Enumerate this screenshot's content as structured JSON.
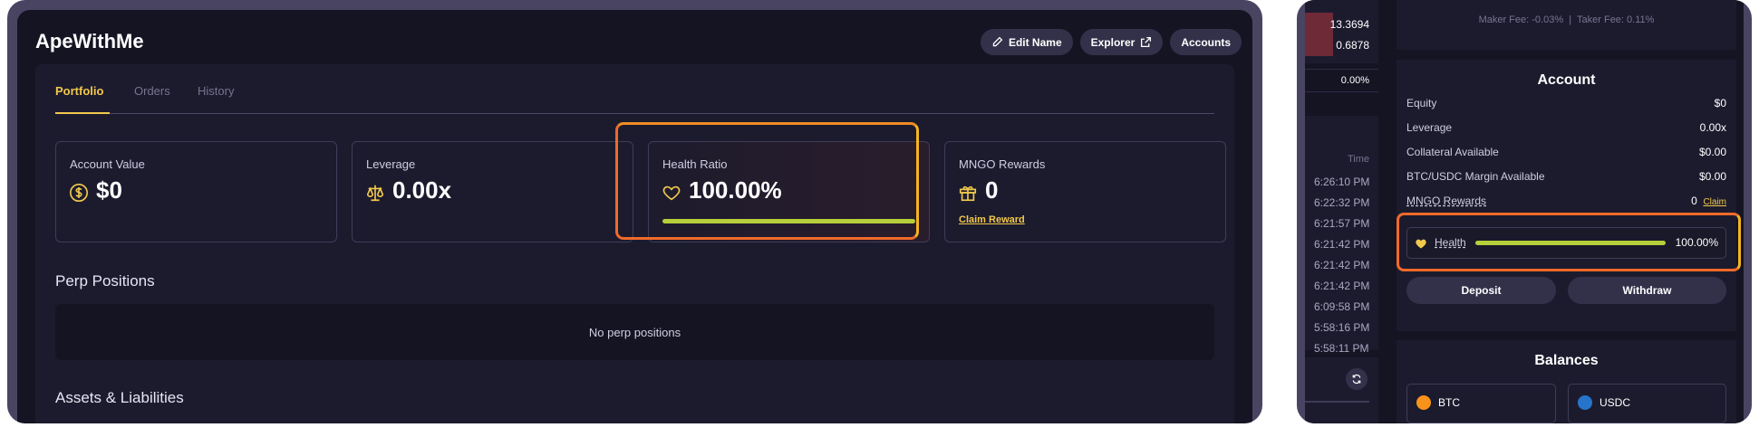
{
  "left": {
    "app_title": "ApeWithMe",
    "header_buttons": {
      "edit_name": "Edit Name",
      "explorer": "Explorer",
      "accounts": "Accounts"
    },
    "tabs": [
      "Portfolio",
      "Orders",
      "History"
    ],
    "stats": {
      "account_value": {
        "label": "Account Value",
        "value": "$0"
      },
      "leverage": {
        "label": "Leverage",
        "value": "0.00x"
      },
      "health_ratio": {
        "label": "Health Ratio",
        "value": "100.00%",
        "fill_fraction": 1.0
      },
      "mngo_rewards": {
        "label": "MNGO Rewards",
        "value": "0",
        "claim": "Claim Reward"
      }
    },
    "perp_positions": {
      "title": "Perp Positions",
      "empty": "No perp positions"
    },
    "assets_title": "Assets & Liabilities"
  },
  "right": {
    "trades": {
      "numbers": [
        "13.3694",
        "0.6878"
      ],
      "percent": "0.00%",
      "time_header": "Time",
      "times": [
        "6:26:10 PM",
        "6:22:32 PM",
        "6:21:57 PM",
        "6:21:42 PM",
        "6:21:42 PM",
        "6:21:42 PM",
        "6:09:58 PM",
        "5:58:16 PM",
        "5:58:11 PM"
      ]
    },
    "fees": {
      "maker": "Maker Fee: -0.03%",
      "sep": "|",
      "taker": "Taker Fee: 0.11%"
    },
    "account": {
      "title": "Account",
      "rows": [
        {
          "label": "Equity",
          "value": "$0"
        },
        {
          "label": "Leverage",
          "value": "0.00x"
        },
        {
          "label": "Collateral Available",
          "value": "$0.00"
        },
        {
          "label": "BTC/USDC Margin Available",
          "value": "$0.00"
        }
      ],
      "mngo_label": "MNGO Rewards",
      "mngo_value": "0",
      "mngo_claim": "Claim",
      "health_label": "Health",
      "health_value": "100.00%",
      "health_fill_fraction": 1.0,
      "deposit": "Deposit",
      "withdraw": "Withdraw"
    },
    "balances": {
      "title": "Balances",
      "assets": [
        "BTC",
        "USDC"
      ]
    }
  },
  "colors": {
    "accent": "#f2c94c",
    "health_bar": "#b7cf3a",
    "glow_orange": "#f06a2a",
    "glow_yellow": "#f5b422"
  }
}
